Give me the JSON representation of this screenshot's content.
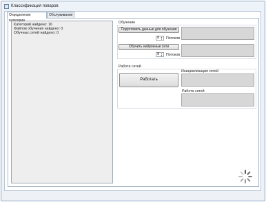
{
  "window": {
    "title": "Классификация поваров"
  },
  "tabs": [
    {
      "label": "Определение категории",
      "active": true
    },
    {
      "label": "Обслуживание",
      "active": false
    }
  ],
  "log": {
    "lines": [
      "Категорий найдено: 16",
      "Файлов обучения найдено: 0",
      "Обучных сетей найдено: 0"
    ]
  },
  "training": {
    "group_title": "Обучение",
    "prepare_button": "Подготовить данные для обучения",
    "prepare_threads_value": "8",
    "prepare_threads_label": "Потоков",
    "train_button": "Обучить нейронные сети",
    "train_threads_value": "8",
    "train_threads_label": "Потоков"
  },
  "network": {
    "group_title": "Работа сетей",
    "work_button": "Работать",
    "init_label": "Инициализация сетей",
    "work_label": "Работа сетей"
  }
}
